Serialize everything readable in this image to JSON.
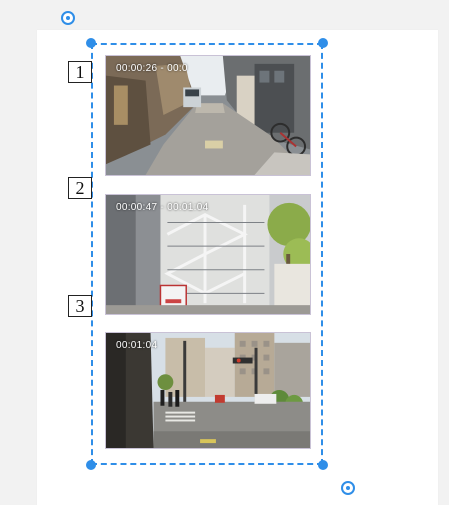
{
  "canvas": {
    "items": [
      {
        "number": "1",
        "timecode": "00:00:26 - 00:0",
        "scene": "narrow alley with parked car and bicycle"
      },
      {
        "number": "2",
        "timecode": "00:00:47 - 00:01:04",
        "scene": "building exterior with fire escape stairs"
      },
      {
        "number": "3",
        "timecode": "00:01:04",
        "scene": "street intersection with traffic lights and pedestrians"
      }
    ]
  },
  "colors": {
    "selection": "#2f8ee8",
    "page": "#ffffff",
    "background": "#f2f2f2",
    "thumb_border": "#c9c2d6"
  },
  "icons": {
    "rotate_handle": "target-circle-icon",
    "resize_handle": "dot-handle-icon"
  }
}
